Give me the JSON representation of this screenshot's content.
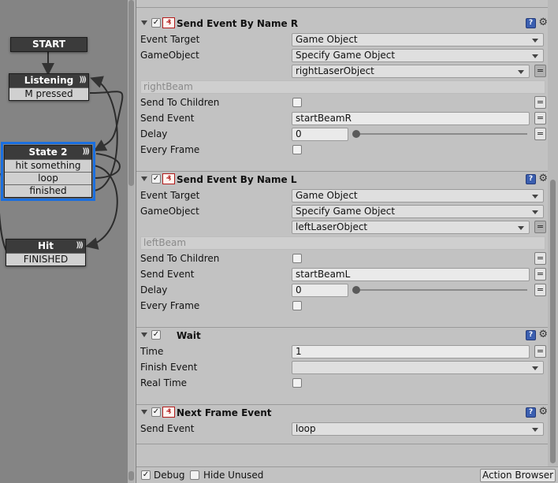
{
  "graph": {
    "nodes": {
      "start": {
        "title": "START"
      },
      "listening": {
        "title": "Listening",
        "events": [
          "M pressed"
        ]
      },
      "state2": {
        "title": "State 2",
        "events": [
          "hit something",
          "loop",
          "finished"
        ]
      },
      "hit": {
        "title": "Hit",
        "events": [
          "FINISHED"
        ]
      }
    }
  },
  "actions": [
    {
      "title": "Send Event By Name R",
      "enabled": true,
      "rows": {
        "event_target": {
          "label": "Event Target",
          "value": "Game Object"
        },
        "gameobject": {
          "label": "GameObject",
          "value": "Specify Game Object"
        },
        "object": {
          "value": "rightLaserObject"
        },
        "variable": {
          "placeholder": "rightBeam"
        },
        "send_to_children": {
          "label": "Send To Children"
        },
        "send_event": {
          "label": "Send Event",
          "value": "startBeamR"
        },
        "delay": {
          "label": "Delay",
          "value": "0"
        },
        "every_frame": {
          "label": "Every Frame"
        }
      }
    },
    {
      "title": "Send Event By Name L",
      "enabled": true,
      "rows": {
        "event_target": {
          "label": "Event Target",
          "value": "Game Object"
        },
        "gameobject": {
          "label": "GameObject",
          "value": "Specify Game Object"
        },
        "object": {
          "value": "leftLaserObject"
        },
        "variable": {
          "placeholder": "leftBeam"
        },
        "send_to_children": {
          "label": "Send To Children"
        },
        "send_event": {
          "label": "Send Event",
          "value": "startBeamL"
        },
        "delay": {
          "label": "Delay",
          "value": "0"
        },
        "every_frame": {
          "label": "Every Frame"
        }
      }
    },
    {
      "title": "Wait",
      "enabled": true,
      "rows": {
        "time": {
          "label": "Time",
          "value": "1"
        },
        "finish_event": {
          "label": "Finish Event",
          "value": ""
        },
        "real_time": {
          "label": "Real Time"
        }
      }
    },
    {
      "title": "Next Frame Event",
      "enabled": true,
      "rows": {
        "send_event": {
          "label": "Send Event",
          "value": "loop"
        }
      }
    }
  ],
  "footer": {
    "debug_label": "Debug",
    "debug_checked": true,
    "hide_unused_label": "Hide Unused",
    "hide_unused_checked": false,
    "action_browser_label": "Action Browser"
  },
  "icons": {
    "collapse": "triangle-down-icon",
    "enabled_check": "checkmark-icon",
    "action": "playmaker-action-icon",
    "help": "help-book-icon",
    "settings": "gear-icon",
    "variable_toggle": "equals-icon",
    "transition": "wifi-arcs-icon"
  },
  "colors": {
    "selected_state": "#1a6fe0",
    "node_header": "#3b3b3b",
    "action_icon": "#b21c1c",
    "help_icon": "#3b5fb0"
  }
}
